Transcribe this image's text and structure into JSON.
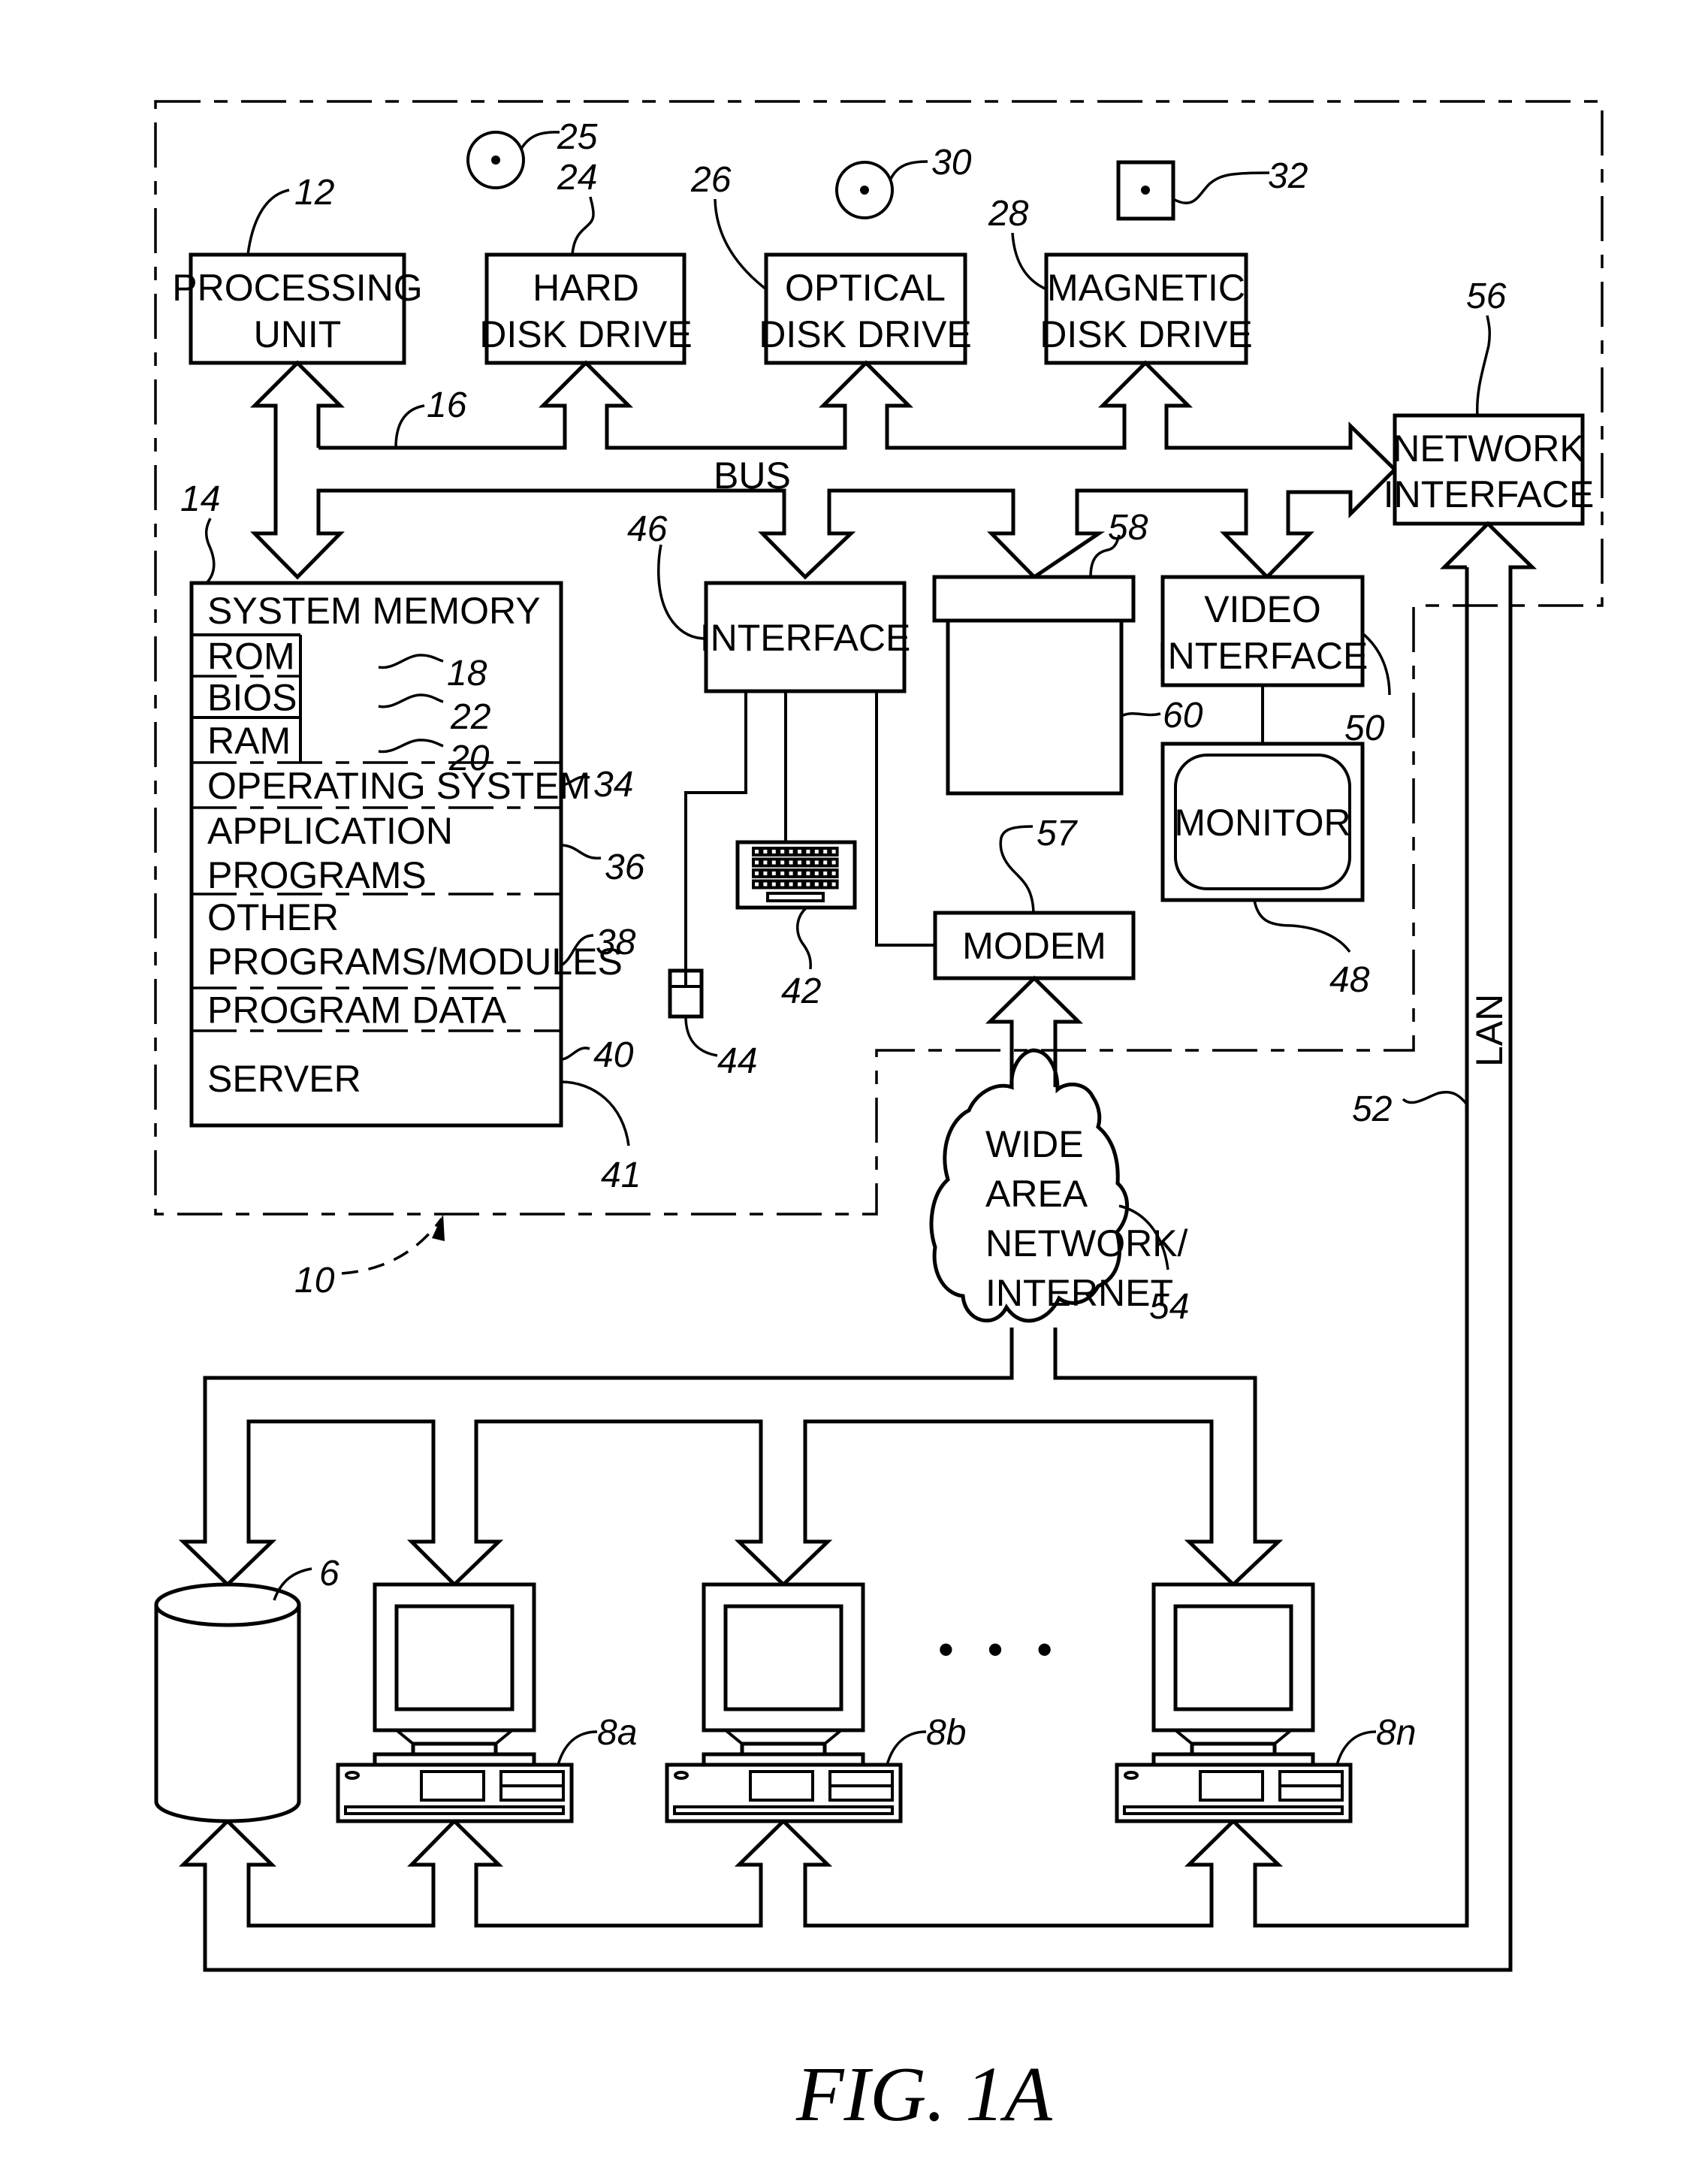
{
  "figure": {
    "caption": "FIG. 1A",
    "colors": {
      "ink": "#000000",
      "paper": "#ffffff"
    }
  },
  "components": {
    "processing_unit": {
      "line1": "PROCESSING",
      "line2": "UNIT",
      "ref": "12"
    },
    "hard_disk_drive": {
      "line1": "HARD",
      "line2": "DISK  DRIVE",
      "ref": "24"
    },
    "optical_disk_drive": {
      "line1": "OPTICAL",
      "line2": "DISK  DRIVE",
      "ref": "26"
    },
    "magnetic_disk_drive": {
      "line1": "MAGNETIC",
      "line2": "DISK  DRIVE",
      "ref": "28"
    },
    "network_interface": {
      "line1": "NETWORK",
      "line2": "INTERFACE",
      "ref": "56"
    },
    "interface": {
      "label": "INTERFACE",
      "ref": "46"
    },
    "video_interface": {
      "line1": "VIDEO",
      "line2": "INTERFACE",
      "ref": "50"
    },
    "monitor": {
      "label": "MONITOR",
      "ref": "48"
    },
    "modem": {
      "label": "MODEM",
      "ref": "57"
    },
    "storage_device": {
      "lid_ref": "58",
      "body_ref": "60"
    },
    "keyboard": {
      "ref": "42"
    },
    "mouse": {
      "ref": "44"
    },
    "hard_disk_media": {
      "ref": "25"
    },
    "optical_disk_media": {
      "ref": "30"
    },
    "magnetic_disk_media": {
      "ref": "32"
    },
    "bus": {
      "label": "BUS",
      "ref": "16"
    },
    "server_computer": {
      "ref": "10"
    },
    "wan": {
      "lines": [
        "WIDE",
        "AREA",
        "NETWORK/",
        "INTERNET"
      ],
      "ref": "54"
    },
    "lan": {
      "label": "LAN",
      "ref": "52"
    },
    "database": {
      "ref": "6"
    },
    "client_computers": [
      {
        "ref": "8a"
      },
      {
        "ref": "8b"
      },
      {
        "ref": "8n"
      }
    ],
    "ellipsis": "• • •"
  },
  "system_memory": {
    "title": "SYSTEM  MEMORY",
    "ref": "14",
    "rows": [
      {
        "label": "ROM",
        "ref": "18"
      },
      {
        "label": "BIOS",
        "ref": "22"
      },
      {
        "label": "RAM",
        "ref": "20"
      },
      {
        "label": "OPERATING  SYSTEM",
        "ref": "34"
      },
      {
        "label": "APPLICATION",
        "label2": "PROGRAMS",
        "ref": "36"
      },
      {
        "label": "OTHER",
        "label2": "PROGRAMS/MODULES",
        "ref": "38"
      },
      {
        "label": "PROGRAM  DATA",
        "ref": "40"
      },
      {
        "label": "SERVER",
        "ref": "41"
      }
    ]
  }
}
